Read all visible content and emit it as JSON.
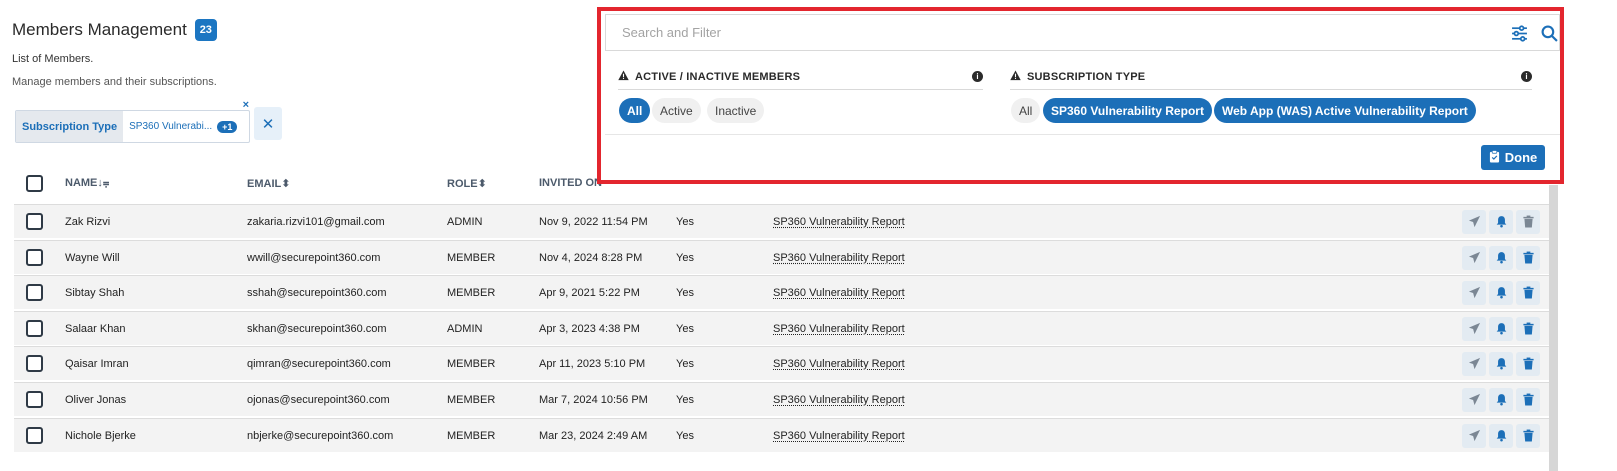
{
  "header": {
    "title": "Members Management",
    "count": "23",
    "subtitle": "List of Members.",
    "description": "Manage members and their subscriptions."
  },
  "active_filter": {
    "key": "Subscription Type",
    "value": "SP360 Vulnerabi...",
    "extra": "+1",
    "remove_icon": "×",
    "clear_icon": "✕"
  },
  "table": {
    "columns": {
      "name": "NAME",
      "email": "EMAIL",
      "role": "ROLE",
      "invited_on": "INVITED ON"
    },
    "rows": [
      {
        "name": "Zak Rizvi",
        "email": "zakaria.rizvi101@gmail.com",
        "role": "ADMIN",
        "invited": "Nov 9, 2022 11:54 PM",
        "active": "Yes",
        "subscription": "SP360 Vulnerability Report"
      },
      {
        "name": "Wayne Will",
        "email": "wwill@securepoint360.com",
        "role": "MEMBER",
        "invited": "Nov 4, 2024 8:28 PM",
        "active": "Yes",
        "subscription": "SP360 Vulnerability Report"
      },
      {
        "name": "Sibtay Shah",
        "email": "sshah@securepoint360.com",
        "role": "MEMBER",
        "invited": "Apr 9, 2021 5:22 PM",
        "active": "Yes",
        "subscription": "SP360 Vulnerability Report"
      },
      {
        "name": "Salaar Khan",
        "email": "skhan@securepoint360.com",
        "role": "ADMIN",
        "invited": "Apr 3, 2023 4:38 PM",
        "active": "Yes",
        "subscription": "SP360 Vulnerability Report"
      },
      {
        "name": "Qaisar Imran",
        "email": "qimran@securepoint360.com",
        "role": "MEMBER",
        "invited": "Apr 11, 2023 5:10 PM",
        "active": "Yes",
        "subscription": "SP360 Vulnerability Report"
      },
      {
        "name": "Oliver Jonas",
        "email": "ojonas@securepoint360.com",
        "role": "MEMBER",
        "invited": "Mar 7, 2024 10:56 PM",
        "active": "Yes",
        "subscription": "SP360 Vulnerability Report"
      },
      {
        "name": "Nichole Bjerke",
        "email": "nbjerke@securepoint360.com",
        "role": "MEMBER",
        "invited": "Mar 23, 2024 2:49 AM",
        "active": "Yes",
        "subscription": "SP360 Vulnerability Report"
      }
    ]
  },
  "filter_panel": {
    "search_placeholder": "Search and Filter",
    "status_section": {
      "title": "ACTIVE / INACTIVE MEMBERS",
      "options": [
        "All",
        "Active",
        "Inactive"
      ],
      "selected": "All"
    },
    "subscription_section": {
      "title": "SUBSCRIPTION TYPE",
      "options": [
        "All",
        "SP360 Vulnerability Report",
        "Web App (WAS) Active Vulnerability Report"
      ],
      "selected": [
        "SP360 Vulnerability Report",
        "Web App (WAS) Active Vulnerability Report"
      ]
    },
    "done_label": "Done"
  },
  "colors": {
    "accent": "#1c6fb8",
    "highlight_border": "#e3262e",
    "delete_red": "#2f6fb0"
  },
  "icons": [
    "sliders-icon",
    "search-icon",
    "warning-icon",
    "info-icon",
    "send-icon",
    "bell-icon",
    "trash-icon",
    "clipboard-icon"
  ]
}
